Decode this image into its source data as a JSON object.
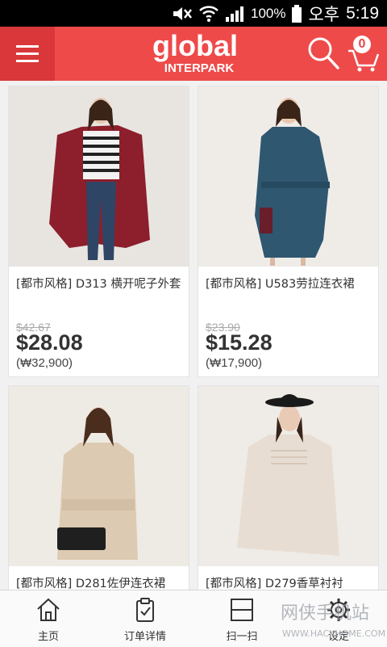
{
  "status_bar": {
    "battery": "100%",
    "ampm": "오후",
    "time": "5:19"
  },
  "header": {
    "logo_main": "global",
    "logo_sub": "INTERPARK",
    "cart_count": "0",
    "brand_color": "#ee4a4a"
  },
  "products": [
    {
      "title": "[都市风格] D313 横开呢子外套",
      "old_price": "$42.67",
      "price": "$28.08",
      "krw": "(₩32,900)"
    },
    {
      "title": "[都市风格] U583劳拉连衣裙",
      "old_price": "$23.90",
      "price": "$15.28",
      "krw": "(₩17,900)"
    },
    {
      "title": "[都市风格] D281佐伊连衣裙",
      "old_price": "",
      "price": "",
      "krw": ""
    },
    {
      "title": "[都市风格] D279香草衬衬",
      "old_price": "",
      "price": "",
      "krw": ""
    }
  ],
  "bottom_nav": [
    {
      "label": "主页",
      "icon": "home-icon"
    },
    {
      "label": "订单详情",
      "icon": "clipboard-check-icon"
    },
    {
      "label": "扫一扫",
      "icon": "scan-icon"
    },
    {
      "label": "设定",
      "icon": "gear-icon"
    }
  ],
  "watermark": {
    "text": "网侠手机站",
    "url": "WWW.HACKHOME.COM"
  }
}
